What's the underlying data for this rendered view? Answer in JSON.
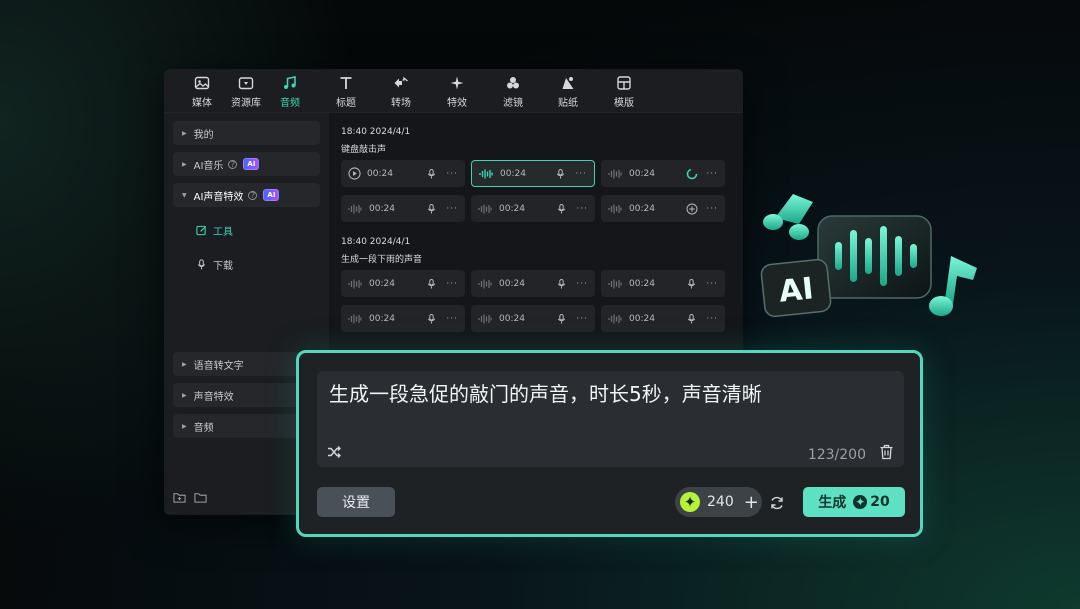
{
  "toolbar": {
    "tabs": [
      {
        "label": "媒体",
        "icon": "image-icon"
      },
      {
        "label": "资源库",
        "icon": "library-icon"
      },
      {
        "label": "音频",
        "icon": "music-note-icon",
        "active": true
      },
      {
        "label": "标题",
        "icon": "text-icon"
      },
      {
        "label": "转场",
        "icon": "transition-icon"
      },
      {
        "label": "特效",
        "icon": "sparkle-icon"
      },
      {
        "label": "滤镜",
        "icon": "filter-icon"
      },
      {
        "label": "贴纸",
        "icon": "sticker-icon"
      },
      {
        "label": "模版",
        "icon": "template-icon"
      }
    ]
  },
  "sidebar": {
    "items": [
      {
        "label": "我的"
      },
      {
        "label": "AI音乐",
        "badge": "AI"
      },
      {
        "label": "AI声音特效",
        "badge": "AI"
      },
      {
        "label": "语音转文字"
      },
      {
        "label": "声音特效"
      },
      {
        "label": "音频"
      }
    ],
    "sub_items": [
      {
        "label": "工具",
        "active": true
      },
      {
        "label": "下载"
      }
    ]
  },
  "content": {
    "groups": [
      {
        "time": "18:40 2024/4/1",
        "title": "键盘敲击声"
      },
      {
        "time": "18:40 2024/4/1",
        "title": "生成一段下雨的声音"
      }
    ],
    "clip_duration": "00:24"
  },
  "prompt": {
    "text": "生成一段急促的敲门的声音，时长5秒，声音清晰",
    "counter": "123/200",
    "settings_label": "设置",
    "credits": "240",
    "plus": "+",
    "generate_label": "生成",
    "generate_cost": "20"
  },
  "art": {
    "label": "AI"
  },
  "colors": {
    "accent": "#3fd2b4",
    "generate_bg": "#5ee0c2",
    "credit_coin": "#b6f23b"
  }
}
